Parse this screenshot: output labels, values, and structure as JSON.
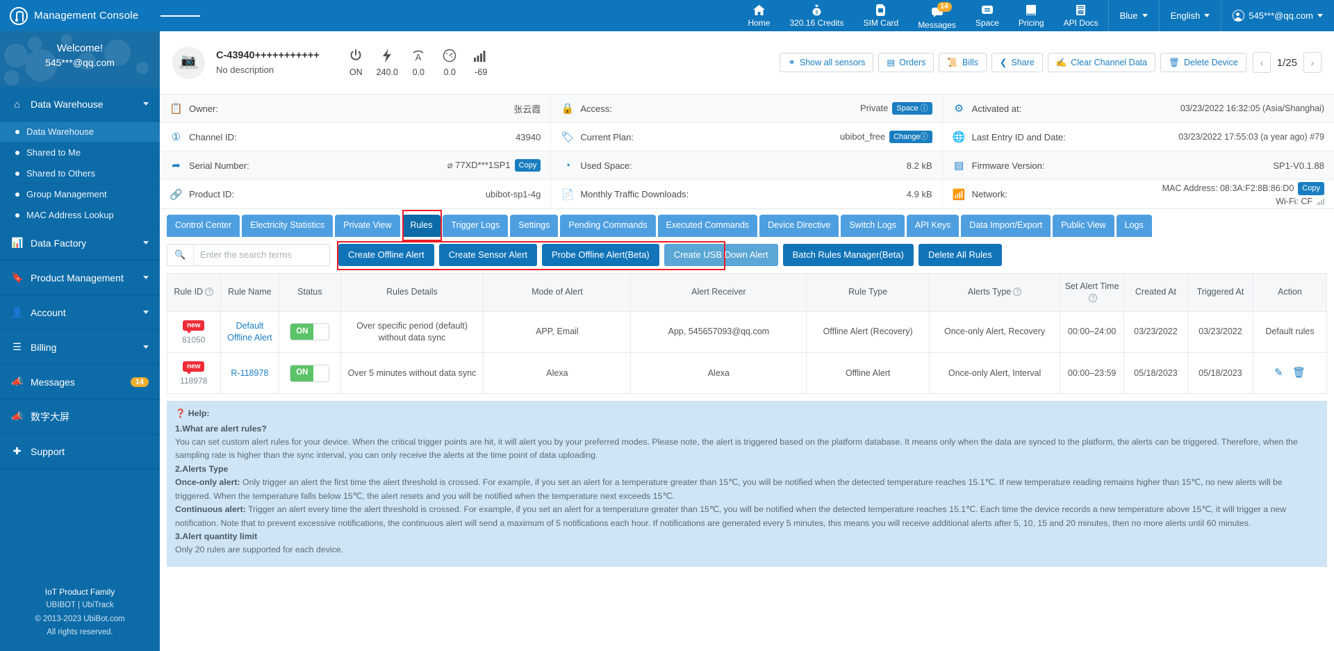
{
  "topbar": {
    "brand": "Management Console",
    "nav": [
      {
        "label": "Home",
        "icon": "home-icon",
        "glyph": "⌂"
      },
      {
        "label": "320.16 Credits",
        "icon": "money-bag-icon",
        "glyph": "●"
      },
      {
        "label": "SIM Card",
        "icon": "sim-card-icon",
        "glyph": "▮"
      },
      {
        "label": "Messages",
        "icon": "message-icon",
        "glyph": "■",
        "badge": "14"
      },
      {
        "label": "Space",
        "icon": "chat-bubble-icon",
        "glyph": "■"
      },
      {
        "label": "Pricing",
        "icon": "book-icon",
        "glyph": "■"
      },
      {
        "label": "API Docs",
        "icon": "api-doc-icon",
        "glyph": "▤"
      }
    ],
    "theme": "Blue",
    "language": "English",
    "account": "545***@qq.com"
  },
  "sidebar": {
    "welcome_title": "Welcome!",
    "welcome_user": "545***@qq.com",
    "data_warehouse": {
      "label": "Data Warehouse",
      "icon": "home-icon"
    },
    "sub_items": [
      {
        "label": "Data Warehouse",
        "active": true
      },
      {
        "label": "Shared to Me",
        "active": false
      },
      {
        "label": "Shared to Others",
        "active": false
      },
      {
        "label": "Group Management",
        "active": false
      },
      {
        "label": "MAC Address Lookup",
        "active": false
      }
    ],
    "items": [
      {
        "label": "Data Factory",
        "icon": "factory-icon",
        "chevron": true
      },
      {
        "label": "Product Management",
        "icon": "bookmark-icon",
        "chevron": true
      },
      {
        "label": "Account",
        "icon": "user-icon",
        "chevron": true
      },
      {
        "label": "Billing",
        "icon": "layers-icon",
        "chevron": true
      },
      {
        "label": "Messages",
        "icon": "megaphone-icon",
        "chevron": false,
        "badge": "14"
      },
      {
        "label": "数字大屏",
        "icon": "megaphone-icon",
        "chevron": false
      },
      {
        "label": "Support",
        "icon": "support-icon",
        "chevron": false
      }
    ],
    "footer": {
      "line1": "IoT Product Family",
      "line2": "UBIBOT | UbiTrack",
      "line3": "© 2013-2023 UbiBot.com",
      "line4": "All rights reserved."
    }
  },
  "device": {
    "picture_placeholder": "No picture",
    "name": "C-43940+++++++++++",
    "description": "No description",
    "stats": [
      {
        "icon": "power-icon",
        "glyph": "⏻",
        "value": "ON"
      },
      {
        "icon": "voltage-icon",
        "glyph": "⚡",
        "value": "240.0"
      },
      {
        "icon": "current-icon",
        "glyph": "A",
        "value": "0.0"
      },
      {
        "icon": "gauge-icon",
        "glyph": "◴",
        "value": "0.0"
      },
      {
        "icon": "signal-bars-icon",
        "glyph": "▂",
        "value": "-69"
      }
    ],
    "actions": [
      {
        "label": "Show all sensors",
        "icon": "sensor-icon",
        "glyph": "⚲"
      },
      {
        "label": "Orders",
        "icon": "order-icon",
        "glyph": "▤"
      },
      {
        "label": "Bills",
        "icon": "bills-icon",
        "glyph": "▧"
      },
      {
        "label": "Share",
        "icon": "share-icon",
        "glyph": "➦"
      },
      {
        "label": "Clear Channel Data",
        "icon": "eraser-icon",
        "glyph": "▰"
      },
      {
        "label": "Delete Device",
        "icon": "trash-icon",
        "glyph": "Ὕ1"
      }
    ],
    "pager": {
      "prev": "‹",
      "text": "1/25",
      "next": "›"
    }
  },
  "info": {
    "col1": [
      {
        "icon": "contact-card-icon",
        "label": "Owner:",
        "value": "张云霞"
      },
      {
        "icon": "number-icon",
        "label": "Channel ID:",
        "value": "43940"
      },
      {
        "icon": "serial-icon",
        "label": "Serial Number:",
        "value": "⌀ 77XD***1SP1",
        "chip": "Copy"
      },
      {
        "icon": "link-icon",
        "label": "Product ID:",
        "value": "ubibot-sp1-4g"
      }
    ],
    "col2": [
      {
        "icon": "lock-icon",
        "label": "Access:",
        "value": "Private",
        "chip": "Space ⓘ"
      },
      {
        "icon": "tag-icon",
        "label": "Current Plan:",
        "value": "ubibot_free",
        "chip": "Changeⓘ"
      },
      {
        "icon": "pie-icon",
        "label": "Used Space:",
        "value": "8.2 kB"
      },
      {
        "icon": "traffic-icon",
        "label": "Monthly Traffic Downloads:",
        "value": "4.9 kB"
      }
    ],
    "col3": [
      {
        "icon": "gear-icon",
        "label": "Activated at:",
        "value": "03/23/2022 16:32:05 (Asia/Shanghai)"
      },
      {
        "icon": "globe-clock-icon",
        "label": "Last Entry ID and Date:",
        "value": "03/23/2022 17:55:03 (a year ago) #79"
      },
      {
        "icon": "chip-icon",
        "label": "Firmware Version:",
        "value": "SP1-V0.1.88"
      },
      {
        "icon": "wifi-icon",
        "label": "Network:",
        "value": "MAC Address: 08:3A:F2:8B:86:D0",
        "chip": "Copy",
        "value2": "Wi-Fi: CF"
      }
    ]
  },
  "tabs": [
    {
      "label": "Control Center",
      "active": false
    },
    {
      "label": "Electricity Statistics",
      "active": false
    },
    {
      "label": "Private View",
      "active": false
    },
    {
      "label": "Rules",
      "active": true
    },
    {
      "label": "Trigger Logs",
      "active": false
    },
    {
      "label": "Settings",
      "active": false
    },
    {
      "label": "Pending Commands",
      "active": false
    },
    {
      "label": "Executed Commands",
      "active": false
    },
    {
      "label": "Device Directive",
      "active": false
    },
    {
      "label": "Switch Logs",
      "active": false
    },
    {
      "label": "API Keys",
      "active": false
    },
    {
      "label": "Data Import/Export",
      "active": false
    },
    {
      "label": "Public View",
      "active": false
    },
    {
      "label": "Logs",
      "active": false
    }
  ],
  "toolbar": {
    "search_placeholder": "Enter the search terms",
    "search_value": "",
    "buttons": [
      {
        "label": "Create Offline Alert",
        "state": "normal"
      },
      {
        "label": "Create Sensor Alert",
        "state": "normal"
      },
      {
        "label": "Probe Offline Alert(Beta)",
        "state": "normal"
      },
      {
        "label": "Create USB Down Alert",
        "state": "hover"
      },
      {
        "label": "Batch Rules Manager(Beta)",
        "state": "normal"
      },
      {
        "label": "Delete All Rules",
        "state": "normal"
      }
    ]
  },
  "table": {
    "headers": [
      "Rule ID",
      "Rule Name",
      "Status",
      "Rules Details",
      "Mode of Alert",
      "Alert Receiver",
      "Rule Type",
      "Alerts Type",
      "Set Alert Time",
      "Created At",
      "Triggered At",
      "Action"
    ],
    "header_help": [
      true,
      false,
      false,
      false,
      false,
      false,
      false,
      true,
      true,
      false,
      false,
      false
    ],
    "rows": [
      {
        "new_tag": "new",
        "rule_id": "81050",
        "rule_name": "Default Offline Alert",
        "status": "ON",
        "details": "Over specific period (default) without data sync",
        "mode": "APP, Email",
        "receiver": "App, 545657093@qq.com",
        "rule_type": "Offline Alert (Recovery)",
        "alerts_type": "Once-only Alert, Recovery",
        "alert_time": "00:00–24:00",
        "created_at": "03/23/2022",
        "triggered_at": "03/23/2022",
        "action_text": "Default rules",
        "has_icons": false
      },
      {
        "new_tag": "new",
        "rule_id": "118978",
        "rule_name": "R-118978",
        "status": "ON",
        "details": "Over 5 minutes without data sync",
        "mode": "Alexa",
        "receiver": "Alexa",
        "rule_type": "Offline Alert",
        "alerts_type": "Once-only Alert, Interval",
        "alert_time": "00:00–23:59",
        "created_at": "05/18/2023",
        "triggered_at": "05/18/2023",
        "action_text": "",
        "has_icons": true
      }
    ]
  },
  "help": {
    "title": "Help:",
    "s1_title": "1.What are alert rules?",
    "s1_body": "You can set custom alert rules for your device. When the critical trigger points are hit, it will alert you by your preferred modes. Please note, the alert is triggered based on the platform database. It means only when the data are synced to the platform, the alerts can be triggered. Therefore, when the sampling rate is higher than the sync interval, you can only receive the alerts at the time point of data uploading.",
    "s2_title": "2.Alerts Type",
    "s2_once_label": "Once-only alert:",
    "s2_once_body": " Only trigger an alert the first time the alert threshold is crossed. For example, if you set an alert for a temperature greater than 15℃, you will be notified when the detected temperature reaches 15.1℃. If new temperature reading remains higher than 15℃, no new alerts will be triggered. When the temperature falls below 15℃, the alert resets and you will be notified when the temperature next exceeds 15℃.",
    "s2_cont_label": "Continuous alert:",
    "s2_cont_body": " Trigger an alert every time the alert threshold is crossed. For example, if you set an alert for a temperature greater than 15℃, you will be notified when the detected temperature reaches 15.1℃. Each time the device records a new temperature above 15℃, it will trigger a new notification. Note that to prevent excessive notifications, the continuous alert will send a maximum of 5 notifications each hour. If notifications are generated every 5 minutes, this means you will receive additional alerts after 5, 10, 15 and 20 minutes, then no more alerts until 60 minutes.",
    "s3_title": "3.Alert quantity limit",
    "s3_body": "Only 20 rules are supported for each device."
  },
  "colors": {
    "brand_blue": "#0e76bc",
    "sidebar_blue": "#0d6ba8",
    "tab_blue": "#4e9fe0",
    "active_tab": "#0d6ba8",
    "button_blue": "#1274b8",
    "hover_blue": "#5aa6d4",
    "toggle_green": "#5cc368",
    "badge_orange": "#f0ad2e",
    "new_red": "#ee2b37",
    "highlight_red": "#ee1c25",
    "help_bg": "#cfe4f5"
  }
}
